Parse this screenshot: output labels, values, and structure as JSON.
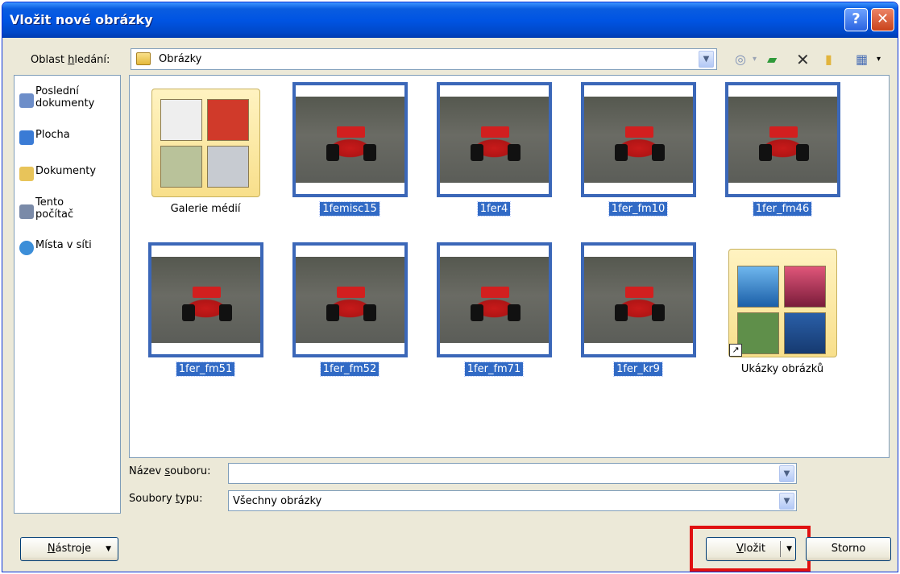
{
  "window": {
    "title": "Vložit nové obrázky",
    "help_glyph": "?",
    "close_glyph": "✕"
  },
  "lookin": {
    "label_pre": "Oblast ",
    "label_key": "h",
    "label_post": "ledání:",
    "value": "Obrázky"
  },
  "toolbar": {
    "icons": [
      "back-icon",
      "up-folder-icon",
      "delete-icon",
      "new-folder-icon",
      "views-icon"
    ]
  },
  "places": [
    {
      "name": "recent",
      "line1": "Poslední",
      "line2": "dokumenty",
      "color": "#6d8ec9"
    },
    {
      "name": "desktop",
      "line1": "Plocha",
      "line2": "",
      "color": "#3a7bd5"
    },
    {
      "name": "documents",
      "line1": "Dokumenty",
      "line2": "",
      "color": "#e8c45a"
    },
    {
      "name": "computer",
      "line1": "Tento",
      "line2": "počítač",
      "color": "#7a8aa8"
    },
    {
      "name": "network",
      "line1": "Místa v síti",
      "line2": "",
      "color": "#3c8ed8"
    }
  ],
  "files": [
    {
      "name": "Galerie médií",
      "kind": "folder",
      "selected": false
    },
    {
      "name": "1femisc15",
      "kind": "image",
      "selected": true
    },
    {
      "name": "1fer4",
      "kind": "image",
      "selected": true
    },
    {
      "name": "1fer_fm10",
      "kind": "image",
      "selected": true
    },
    {
      "name": "1fer_fm46",
      "kind": "image",
      "selected": true
    },
    {
      "name": "1fer_fm51",
      "kind": "image",
      "selected": true
    },
    {
      "name": "1fer_fm52",
      "kind": "image",
      "selected": true
    },
    {
      "name": "1fer_fm71",
      "kind": "image",
      "selected": true
    },
    {
      "name": "1fer_kr9",
      "kind": "image",
      "selected": true
    },
    {
      "name": "Ukázky obrázků",
      "kind": "folder",
      "selected": false
    }
  ],
  "filename": {
    "label_pre": "Název ",
    "label_key": "s",
    "label_post": "ouboru:",
    "value": ""
  },
  "filetype": {
    "label_pre": "Soubory ",
    "label_key": "t",
    "label_post": "ypu:",
    "value": "Všechny obrázky"
  },
  "buttons": {
    "tools_key": "N",
    "tools_rest": "ástroje",
    "insert_key": "V",
    "insert_rest": "ložit",
    "cancel": "Storno"
  },
  "colors": {
    "accent": "#316ac5",
    "highlight_frame": "#e01010",
    "title_bar": "#0054e3"
  }
}
